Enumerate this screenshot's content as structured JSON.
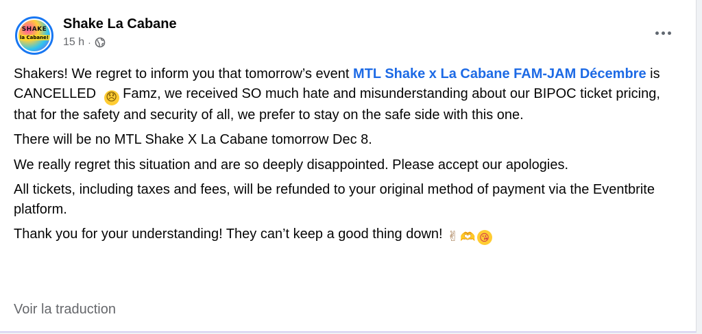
{
  "post": {
    "page_name": "Shake La Cabane",
    "avatar": {
      "line1": "SHAKE",
      "line2": "la Cabane!"
    },
    "timestamp": "15 h",
    "separator": "·",
    "audience_icon": "globe-icon",
    "more_icon": "more-options-icon",
    "paragraph1": {
      "intro": "Shakers! We regret to inform you that tomorrow’s event ",
      "event_link": "MTL Shake x La Cabane FAM-JAM Décembre",
      "middle": " is CANCELLED ",
      "emoji": "😞",
      "rest": " Famz, we received SO much hate and misunderstanding about our BIPOC ticket pricing, that for the safety and security of all, we prefer to stay on the safe side with this one."
    },
    "paragraph2": "There will be no MTL Shake X La Cabane tomorrow Dec 8.",
    "paragraph3": "We really regret this situation and are so deeply disappointed. Please accept our apologies.",
    "paragraph4": "All tickets, including taxes and fees, will be refunded to your original method of payment via the Eventbrite platform.",
    "paragraph5": {
      "text": "Thank you for your understanding! They can’t keep a good thing down!",
      "emoji1": "✌",
      "emoji2": "🫶",
      "emoji3": "😘"
    },
    "translate_label": "Voir la traduction"
  },
  "colors": {
    "link": "#1d6ae5",
    "text": "#050505",
    "secondary": "#65676b",
    "avatar_ring": "#1877f2"
  }
}
